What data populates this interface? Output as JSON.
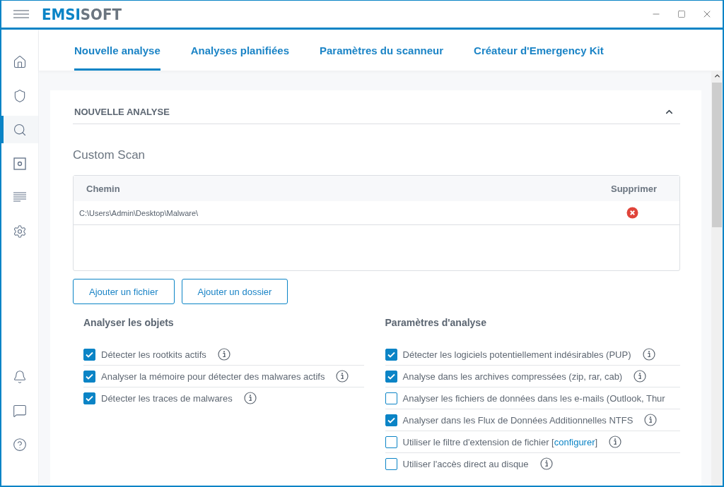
{
  "logo": {
    "primary": "EMSI",
    "secondary": "SOFT"
  },
  "sidebar": {
    "items": [
      {
        "kind": "home",
        "selected": false
      },
      {
        "kind": "shield",
        "selected": false
      },
      {
        "kind": "search",
        "selected": true
      },
      {
        "kind": "disc",
        "selected": false
      },
      {
        "kind": "list",
        "selected": false
      },
      {
        "kind": "gear",
        "selected": false
      }
    ],
    "bottom_items": [
      {
        "kind": "bell"
      },
      {
        "kind": "chat"
      },
      {
        "kind": "help"
      }
    ]
  },
  "tabs": [
    {
      "label": "Nouvelle analyse",
      "selected": true
    },
    {
      "label": "Analyses planifiées",
      "selected": false
    },
    {
      "label": "Paramètres du scanneur",
      "selected": false
    },
    {
      "label": "Créateur d'Emergency Kit",
      "selected": false
    }
  ],
  "section": {
    "title": "NOUVELLE ANALYSE",
    "expanded": true,
    "subtitle": "Custom Scan",
    "table": {
      "columns": [
        "Chemin",
        "Supprimer"
      ],
      "rows": [
        {
          "path": "C:\\Users\\Admin\\Desktop\\Malware\\"
        }
      ]
    },
    "buttons": [
      "Ajouter un fichier",
      "Ajouter un dossier"
    ],
    "groups": [
      {
        "title": "Analyser les objets",
        "options": [
          {
            "label": "Détecter les rootkits actifs",
            "checked": true,
            "info": true
          },
          {
            "label": "Analyser la mémoire pour détecter des malwares actifs",
            "checked": true,
            "info": true
          },
          {
            "label": "Détecter les traces de malwares",
            "checked": true,
            "info": true
          }
        ]
      },
      {
        "title": "Paramètres d'analyse",
        "options": [
          {
            "label": "Détecter les logiciels potentiellement indésirables (PUP)",
            "checked": true,
            "info": true
          },
          {
            "label": "Analyse dans les archives compressées (zip, rar, cab)",
            "checked": true,
            "info": true
          },
          {
            "label": "Analyser les fichiers de données dans les e-mails (Outlook, Thur",
            "checked": false,
            "info": false
          },
          {
            "label": "Analyser dans les Flux de Données Additionnelles NTFS",
            "checked": true,
            "info": true
          },
          {
            "label": "Utiliser le filtre d'extension de fichier [",
            "link": "configurer",
            "after": "]",
            "checked": false,
            "info": true
          },
          {
            "label": "Utiliser l'accès direct au disque",
            "checked": false,
            "info": true
          }
        ]
      }
    ]
  }
}
